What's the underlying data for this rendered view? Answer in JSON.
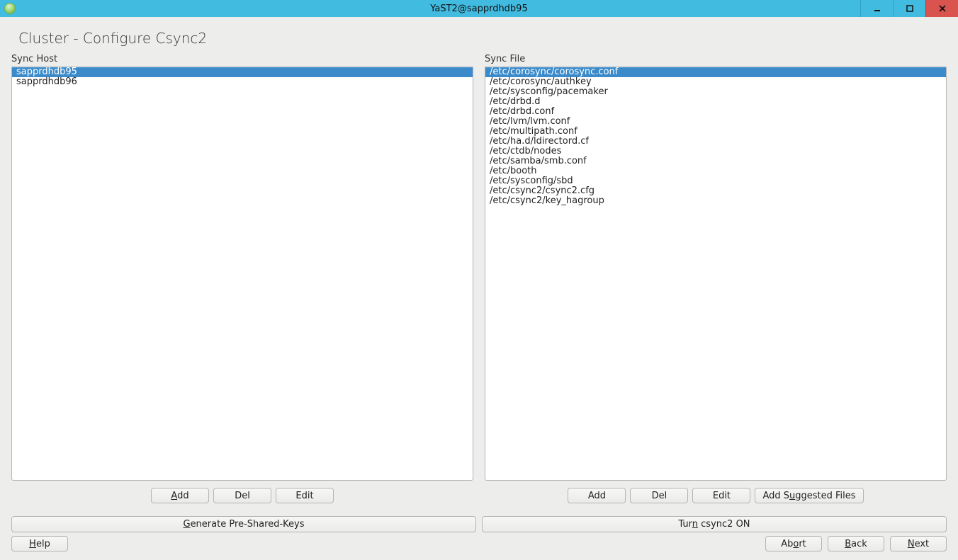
{
  "window": {
    "title": "YaST2@sapprdhdb95"
  },
  "page": {
    "title": "Cluster - Configure Csync2"
  },
  "sync_host": {
    "label": "Sync Host",
    "items": [
      "sapprdhdb95",
      "sapprdhdb96"
    ],
    "selected_index": 0,
    "buttons": {
      "add": "Add",
      "del": "Del",
      "edit": "Edit"
    },
    "mn": {
      "add_u": "A",
      "add_rest": "dd"
    }
  },
  "sync_file": {
    "label": "Sync File",
    "items": [
      "/etc/corosync/corosync.conf",
      "/etc/corosync/authkey",
      "/etc/sysconfig/pacemaker",
      "/etc/drbd.d",
      "/etc/drbd.conf",
      "/etc/lvm/lvm.conf",
      "/etc/multipath.conf",
      "/etc/ha.d/ldirectord.cf",
      "/etc/ctdb/nodes",
      "/etc/samba/smb.conf",
      "/etc/booth",
      "/etc/sysconfig/sbd",
      "/etc/csync2/csync2.cfg",
      "/etc/csync2/key_hagroup"
    ],
    "selected_index": 0,
    "buttons": {
      "add": "Add",
      "del": "Del",
      "edit": "Edit",
      "suggested_pre": "Add S",
      "suggested_u": "u",
      "suggested_post": "ggested Files"
    }
  },
  "center_buttons": {
    "generate_pre": "",
    "generate_u": "G",
    "generate_post": "enerate Pre-Shared-Keys",
    "turn_pre": "Tur",
    "turn_u": "n",
    "turn_post": " csync2 ON"
  },
  "nav": {
    "help_u": "H",
    "help_rest": "elp",
    "abort_pre": "Ab",
    "abort_u": "o",
    "abort_post": "rt",
    "back_u": "B",
    "back_rest": "ack",
    "next_u": "N",
    "next_rest": "ext"
  }
}
